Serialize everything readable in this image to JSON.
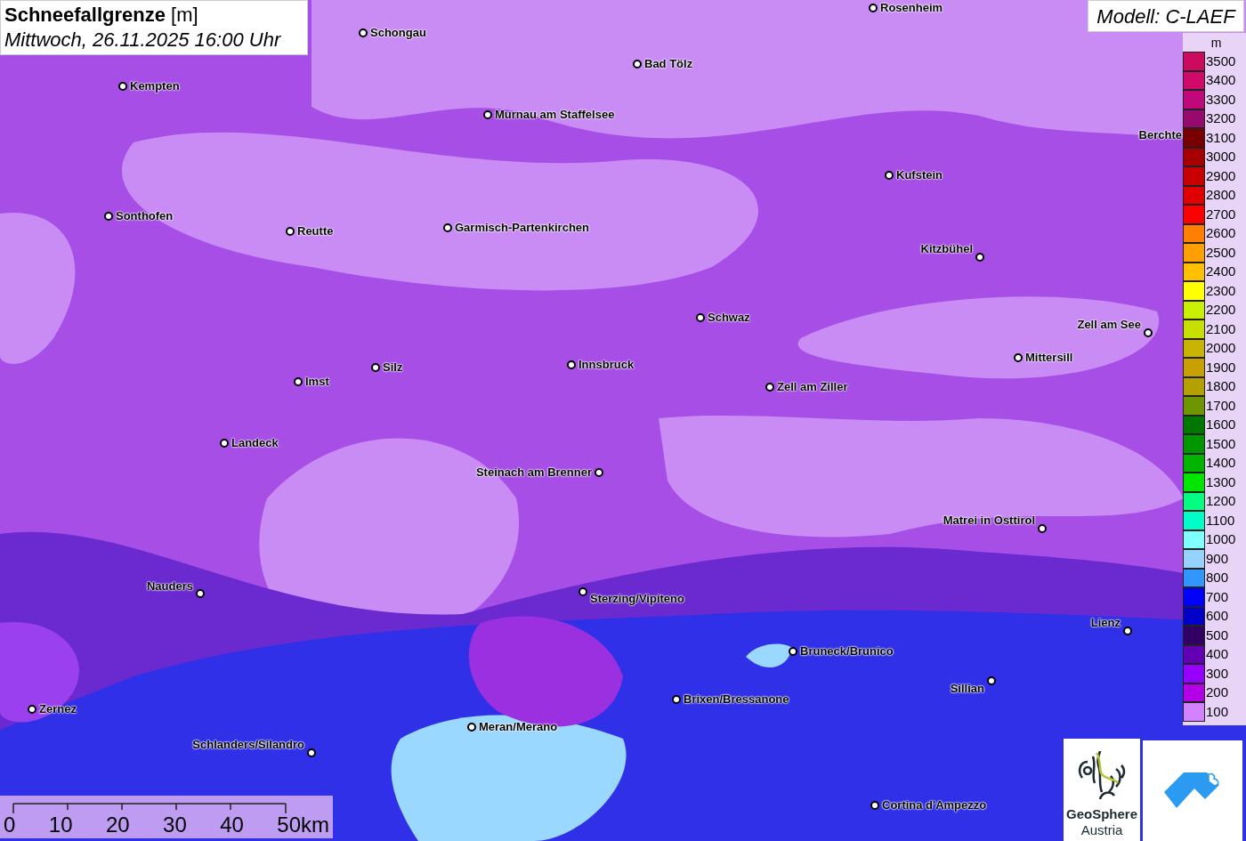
{
  "title": {
    "heading": "**Schneefallgrenze** [m]",
    "datetime": "Mittwoch, 26.11.2025 16:00 Uhr"
  },
  "model": "Modell: C-LAEF",
  "cities": [
    {
      "name": "Rosenheim"
    },
    {
      "name": "Schongau"
    },
    {
      "name": "Bad Tölz"
    },
    {
      "name": "Kempten"
    },
    {
      "name": "Murnau am Staffelsee"
    },
    {
      "name": "Berchte"
    },
    {
      "name": "Kufstein"
    },
    {
      "name": "Sonthofen"
    },
    {
      "name": "Reutte"
    },
    {
      "name": "Garmisch-Partenkirchen"
    },
    {
      "name": "Kitzbühel"
    },
    {
      "name": "Schwaz"
    },
    {
      "name": "Zell am See"
    },
    {
      "name": "Mittersill"
    },
    {
      "name": "Innsbruck"
    },
    {
      "name": "Silz"
    },
    {
      "name": "Imst"
    },
    {
      "name": "Zell am Ziller"
    },
    {
      "name": "Landeck"
    },
    {
      "name": "Steinach am Brenner"
    },
    {
      "name": "Matrei in Osttirol"
    },
    {
      "name": "Nauders"
    },
    {
      "name": "Sterzing/Vipiteno"
    },
    {
      "name": "Lienz"
    },
    {
      "name": "Bruneck/Brunico"
    },
    {
      "name": "Sillian"
    },
    {
      "name": "Zernez"
    },
    {
      "name": "Brixen/Bressanone"
    },
    {
      "name": "Meran/Merano"
    },
    {
      "name": "Schlanders/Silandro"
    },
    {
      "name": "Cortina d'Ampezzo"
    }
  ],
  "legend": {
    "unit": "m",
    "items": [
      {
        "label": "3500",
        "color": "#cc0a5e"
      },
      {
        "label": "3400",
        "color": "#d00a6a"
      },
      {
        "label": "3300",
        "color": "#c0087a"
      },
      {
        "label": "3200",
        "color": "#960a6e"
      },
      {
        "label": "3100",
        "color": "#780000"
      },
      {
        "label": "3000",
        "color": "#a80000"
      },
      {
        "label": "2900",
        "color": "#c80000"
      },
      {
        "label": "2800",
        "color": "#e00000"
      },
      {
        "label": "2700",
        "color": "#ff0000"
      },
      {
        "label": "2600",
        "color": "#ff7f00"
      },
      {
        "label": "2500",
        "color": "#ffa000"
      },
      {
        "label": "2400",
        "color": "#ffc000"
      },
      {
        "label": "2300",
        "color": "#ffff00"
      },
      {
        "label": "2200",
        "color": "#c8f000"
      },
      {
        "label": "2100",
        "color": "#c8e000"
      },
      {
        "label": "2000",
        "color": "#c8b400"
      },
      {
        "label": "1900",
        "color": "#c8a000"
      },
      {
        "label": "1800",
        "color": "#b4a000"
      },
      {
        "label": "1700",
        "color": "#6e9600"
      },
      {
        "label": "1600",
        "color": "#007800"
      },
      {
        "label": "1500",
        "color": "#009600"
      },
      {
        "label": "1400",
        "color": "#00b400"
      },
      {
        "label": "1300",
        "color": "#00e600"
      },
      {
        "label": "1200",
        "color": "#00ff80"
      },
      {
        "label": "1100",
        "color": "#00ffc8"
      },
      {
        "label": "1000",
        "color": "#80ffff"
      },
      {
        "label": "900",
        "color": "#96d2ff"
      },
      {
        "label": "800",
        "color": "#3296ff"
      },
      {
        "label": "700",
        "color": "#0000ff"
      },
      {
        "label": "600",
        "color": "#0000c8"
      },
      {
        "label": "500",
        "color": "#320064"
      },
      {
        "label": "400",
        "color": "#6400b4"
      },
      {
        "label": "300",
        "color": "#9600ff"
      },
      {
        "label": "200",
        "color": "#b400e6"
      },
      {
        "label": "100",
        "color": "#d282ff"
      }
    ]
  },
  "scale_bar": [
    "0",
    "10",
    "20",
    "30",
    "40",
    "50km"
  ],
  "logo": {
    "line1": "GeoSphere",
    "line2": "Austria"
  }
}
